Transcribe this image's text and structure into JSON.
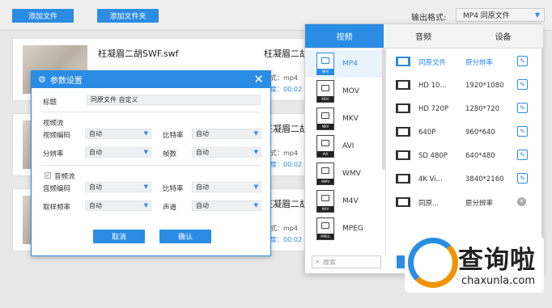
{
  "toolbar": {
    "add_file": "添加文件",
    "add_folder": "添加文件夹",
    "output_format_label": "输出格式:",
    "output_format_value": "MP4  同原文件"
  },
  "files": [
    {
      "title": "枉凝眉二胡SWF.swf",
      "title_right": "枉凝眉二胡",
      "meta1": "式：mp4",
      "meta2": "度：00:02"
    },
    {
      "title": "",
      "title_right": "枉凝眉二胡",
      "meta1": "式：mp4",
      "meta2": "度：00:02"
    },
    {
      "title": "",
      "title_right": "枉凝眉二胡",
      "meta1": "式：mp4",
      "meta2": "度：00:02"
    }
  ],
  "dialog": {
    "title": "参数设置",
    "subject_label": "标题",
    "subject_value": "同原文件 自定义",
    "video_stream": "视频流",
    "video_codec_label": "视频编码",
    "video_codec_value": "自动",
    "bitrate_label": "比特率",
    "bitrate_value": "自动",
    "resolution_label": "分辨率",
    "resolution_value": "自动",
    "framerate_label": "帧数",
    "framerate_value": "自动",
    "audio_stream": "音频流",
    "audio_codec_label": "音频编码",
    "audio_codec_value": "自动",
    "audio_bitrate_label": "比特率",
    "audio_bitrate_value": "自动",
    "sample_rate_label": "取样频率",
    "sample_rate_value": "自动",
    "channel_label": "声道",
    "channel_value": "自动",
    "cancel": "取消",
    "confirm": "确认"
  },
  "panel": {
    "tabs": [
      "视频",
      "音频",
      "设备"
    ],
    "formats": [
      "MP4",
      "MOV",
      "MKV",
      "AVI",
      "WMV",
      "M4V",
      "MPEG"
    ],
    "search_placeholder": "搜索",
    "presets": [
      {
        "name": "同原文件",
        "res": "原分辨率",
        "action": "edit"
      },
      {
        "name": "HD 10...",
        "res": "1920*1080",
        "action": "edit"
      },
      {
        "name": "HD 720P",
        "res": "1280*720",
        "action": "edit"
      },
      {
        "name": "640P",
        "res": "960*640",
        "action": "edit"
      },
      {
        "name": "SD 480P",
        "res": "640*480",
        "action": "edit"
      },
      {
        "name": "4K Vi...",
        "res": "3840*2160",
        "action": "edit"
      },
      {
        "name": "同原...",
        "res": "原分辨率",
        "action": "remove"
      }
    ]
  },
  "watermark": {
    "cn": "查询啦",
    "en": "chaxunla.com"
  },
  "colors": {
    "accent": "#2b8ce3",
    "orange": "#f39200"
  }
}
